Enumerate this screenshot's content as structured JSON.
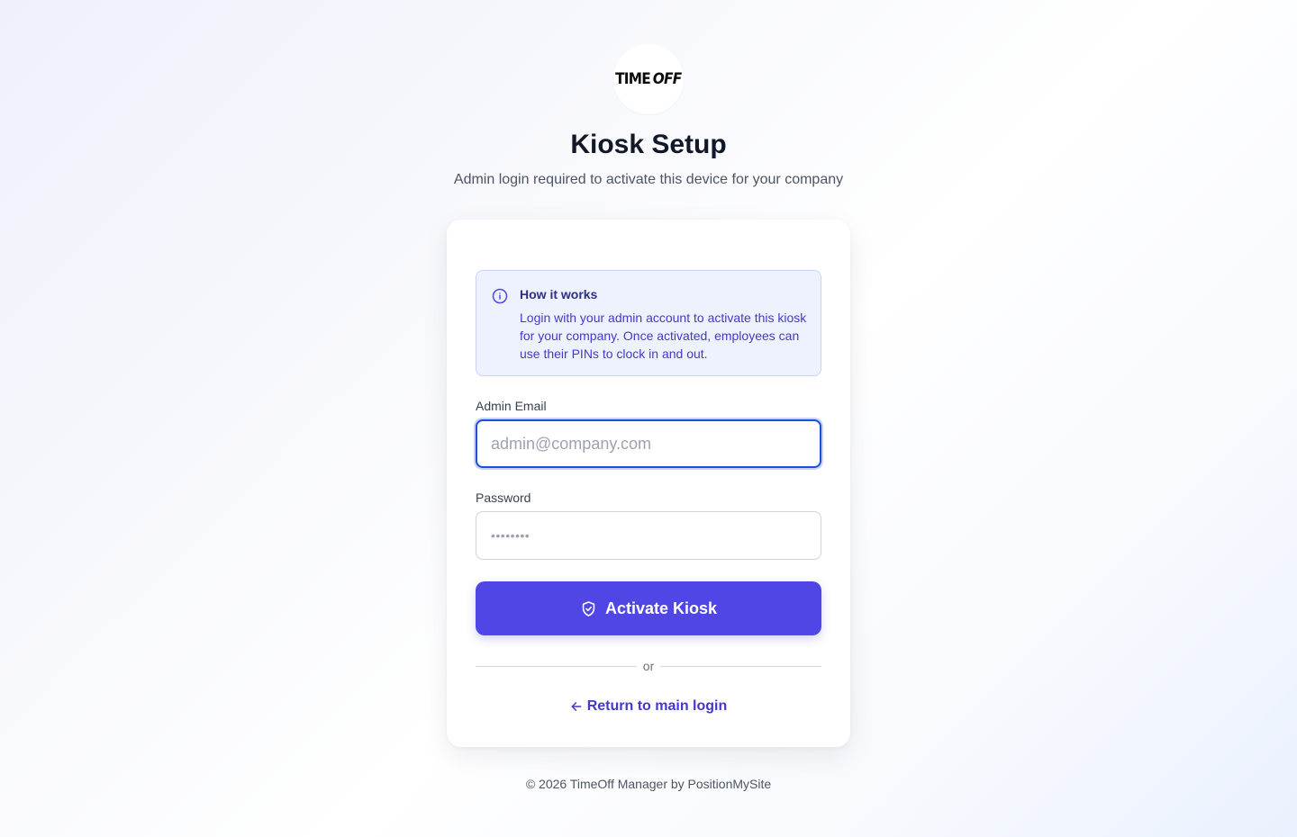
{
  "brand": {
    "logo_time": "TIME",
    "logo_off": "OFF"
  },
  "header": {
    "title": "Kiosk Setup",
    "subtitle": "Admin login required to activate this device for your company"
  },
  "info": {
    "icon": "info-icon",
    "title": "How it works",
    "body": "Login with your admin account to activate this kiosk for your company. Once activated, employees can use their PINs to clock in and out."
  },
  "form": {
    "email_label": "Admin Email",
    "email_placeholder": "admin@company.com",
    "email_value": "",
    "password_label": "Password",
    "password_placeholder": "••••••••",
    "password_value": "",
    "submit_icon": "shield-check-icon",
    "submit_label": "Activate Kiosk",
    "divider_text": "or",
    "return_icon": "arrow-left-icon",
    "return_label": "Return to main login"
  },
  "footer": {
    "copyright": "© 2026 TimeOff Manager by PositionMySite"
  },
  "colors": {
    "primary": "#4f46e5",
    "info_bg": "#eef2ff",
    "info_border": "#c7d2fe",
    "link": "#4338ca",
    "focus_ring": "#1d4ed8"
  }
}
